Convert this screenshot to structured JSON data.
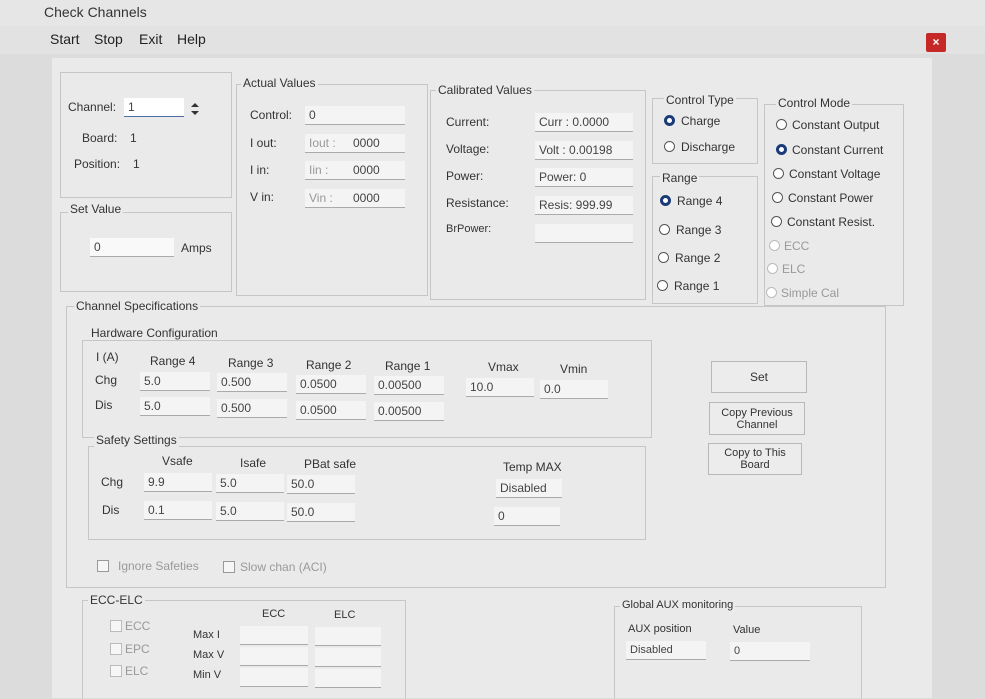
{
  "window": {
    "title": "Check Channels",
    "close_icon": "×"
  },
  "menu": [
    "Start",
    "Stop",
    "Exit",
    "Help"
  ],
  "channel_info": {
    "channel_label": "Channel:",
    "channel_value": "1",
    "board_label": "Board:",
    "board_value": "1",
    "position_label": "Position:",
    "position_value": "1"
  },
  "set_value": {
    "title": "Set Value",
    "value": "0",
    "unit": "Amps"
  },
  "actual_values": {
    "title": "Actual Values",
    "control_label": "Control:",
    "control_value": "0",
    "rows": [
      {
        "label": "I out:",
        "field": "Iout :",
        "value": "0000"
      },
      {
        "label": "I in:",
        "field": "Iin :",
        "value": "0000"
      },
      {
        "label": "V in:",
        "field": "Vin :",
        "value": "0000"
      }
    ]
  },
  "calibrated_values": {
    "title": "Calibrated Values",
    "rows": [
      {
        "label": "Current:",
        "value": "Curr : 0.0000"
      },
      {
        "label": "Voltage:",
        "value": "Volt : 0.00198"
      },
      {
        "label": "Power:",
        "value": "Power: 0"
      },
      {
        "label": "Resistance:",
        "value": "Resis: 999.99"
      },
      {
        "label": "BrPower:",
        "value": ""
      }
    ]
  },
  "control_type": {
    "title": "Control Type",
    "options": [
      "Charge",
      "Discharge"
    ],
    "selected": "Charge"
  },
  "range": {
    "title": "Range",
    "options": [
      "Range 4",
      "Range 3",
      "Range 2",
      "Range 1"
    ],
    "selected": "Range 4"
  },
  "control_mode": {
    "title": "Control Mode",
    "options": [
      "Constant Output",
      "Constant Current",
      "Constant Voltage",
      "Constant Power",
      "Constant Resist.",
      "ECC",
      "ELC",
      "Simple Cal"
    ],
    "selected": "Constant Current"
  },
  "channel_specs": {
    "title": "Channel Specifications",
    "hardware": {
      "title": "Hardware Configuration",
      "corner": "I (A)",
      "headers": [
        "Range 4",
        "Range 3",
        "Range 2",
        "Range 1"
      ],
      "rows": [
        {
          "label": "Chg",
          "values": [
            "5.0",
            "0.500",
            "0.0500",
            "0.00500"
          ]
        },
        {
          "label": "Dis",
          "values": [
            "5.0",
            "0.500",
            "0.0500",
            "0.00500"
          ]
        }
      ],
      "vmax_label": "Vmax",
      "vmax_value": "10.0",
      "vmin_label": "Vmin",
      "vmin_value": "0.0"
    },
    "safety": {
      "title": "Safety Settings",
      "headers": [
        "Vsafe",
        "Isafe",
        "PBat safe"
      ],
      "rows": [
        {
          "label": "Chg",
          "values": [
            "9.9",
            "5.0",
            "50.0"
          ]
        },
        {
          "label": "Dis",
          "values": [
            "0.1",
            "5.0",
            "50.0"
          ]
        }
      ],
      "temp_label": "Temp MAX",
      "temp_value": "Disabled",
      "temp_value2": "0"
    },
    "buttons": {
      "set": "Set",
      "copy_prev": "Copy Previous Channel",
      "copy_board": "Copy to This Board"
    }
  },
  "checkboxes": {
    "ignore": "Ignore Safeties",
    "slow": "Slow chan (ACI)"
  },
  "ecc_elc": {
    "title": "ECC-ELC",
    "checks": [
      "ECC",
      "EPC",
      "ELC"
    ],
    "col_headers": [
      "ECC",
      "ELC"
    ],
    "row_labels": [
      "Max I",
      "Max V",
      "Min V"
    ]
  },
  "aux": {
    "title": "Global AUX monitoring",
    "position_label": "AUX position",
    "value_label": "Value",
    "position_value": "Disabled",
    "value_value": "0"
  }
}
